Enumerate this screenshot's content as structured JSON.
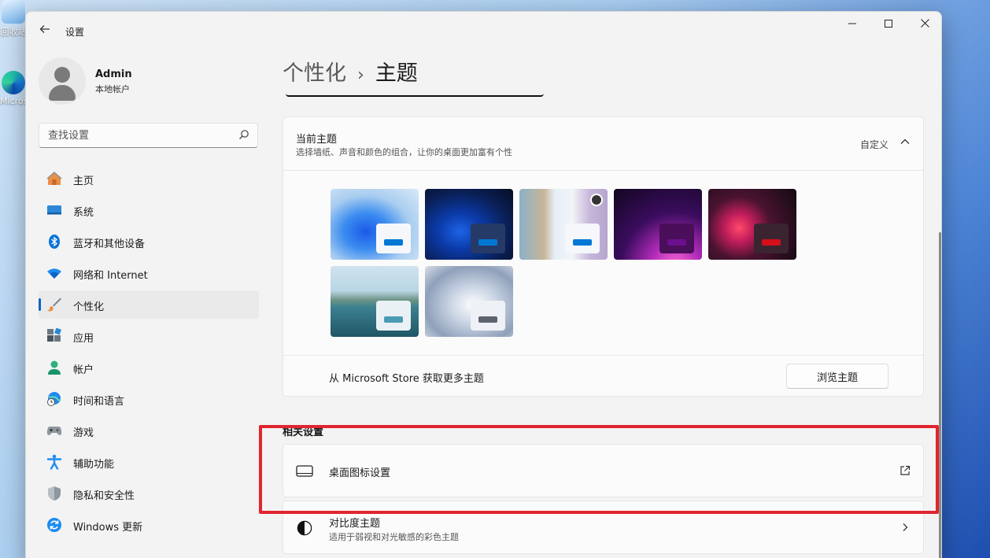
{
  "desktop": {
    "recycle_label": "回收站",
    "edge_label": "Microsoft Edge"
  },
  "window": {
    "title": "设置",
    "back_icon": "arrow-left-icon",
    "minimize_icon": "minimize-icon",
    "maximize_icon": "maximize-icon",
    "close_icon": "close-icon"
  },
  "profile": {
    "name": "Admin",
    "account_type": "本地帐户"
  },
  "search": {
    "placeholder": "查找设置"
  },
  "sidebar": {
    "selected": "个性化",
    "items": [
      {
        "label": "主页",
        "icon": "home-icon"
      },
      {
        "label": "系统",
        "icon": "system-monitor-icon"
      },
      {
        "label": "蓝牙和其他设备",
        "icon": "bluetooth-icon"
      },
      {
        "label": "网络和 Internet",
        "icon": "wifi-icon"
      },
      {
        "label": "个性化",
        "icon": "brush-icon"
      },
      {
        "label": "应用",
        "icon": "apps-icon"
      },
      {
        "label": "帐户",
        "icon": "account-icon"
      },
      {
        "label": "时间和语言",
        "icon": "globe-clock-icon"
      },
      {
        "label": "游戏",
        "icon": "gamepad-icon"
      },
      {
        "label": "辅助功能",
        "icon": "accessibility-icon"
      },
      {
        "label": "隐私和安全性",
        "icon": "shield-icon"
      },
      {
        "label": "Windows 更新",
        "icon": "update-icon"
      }
    ]
  },
  "breadcrumb": {
    "parent": "个性化",
    "separator": "›",
    "current": "主题"
  },
  "current_theme": {
    "title": "当前主题",
    "subtitle": "选择墙纸、声音和颜色的组合，让你的桌面更加富有个性",
    "value": "自定义",
    "themes": [
      {
        "name": "windows-light-bloom",
        "accent": "#0078d4",
        "selected": false
      },
      {
        "name": "windows-dark-bloom",
        "accent": "#0078d4",
        "selected": false
      },
      {
        "name": "flower-dynamic",
        "accent": "#0078d4",
        "selected": true
      },
      {
        "name": "glow",
        "accent": "#6b0f8c",
        "selected": false
      },
      {
        "name": "captured-motion",
        "accent": "#d30f1a",
        "selected": false
      },
      {
        "name": "sunrise-lake",
        "accent": "#4a9bb5",
        "selected": false
      },
      {
        "name": "flow",
        "accent": "#5d6470",
        "selected": false
      }
    ],
    "store_text": "从 Microsoft Store 获取更多主题",
    "browse_button": "浏览主题"
  },
  "related": {
    "section_title": "相关设置",
    "items": [
      {
        "title": "桌面图标设置",
        "subtitle": "",
        "icon": "monitor-icon",
        "trail_icon": "external-link-icon"
      },
      {
        "title": "对比度主题",
        "subtitle": "适用于弱视和对光敏感的彩色主题",
        "icon": "contrast-icon",
        "trail_icon": "chevron-right-icon"
      }
    ]
  },
  "colors": {
    "accent": "#0067c0",
    "highlight": "#e1252f"
  }
}
